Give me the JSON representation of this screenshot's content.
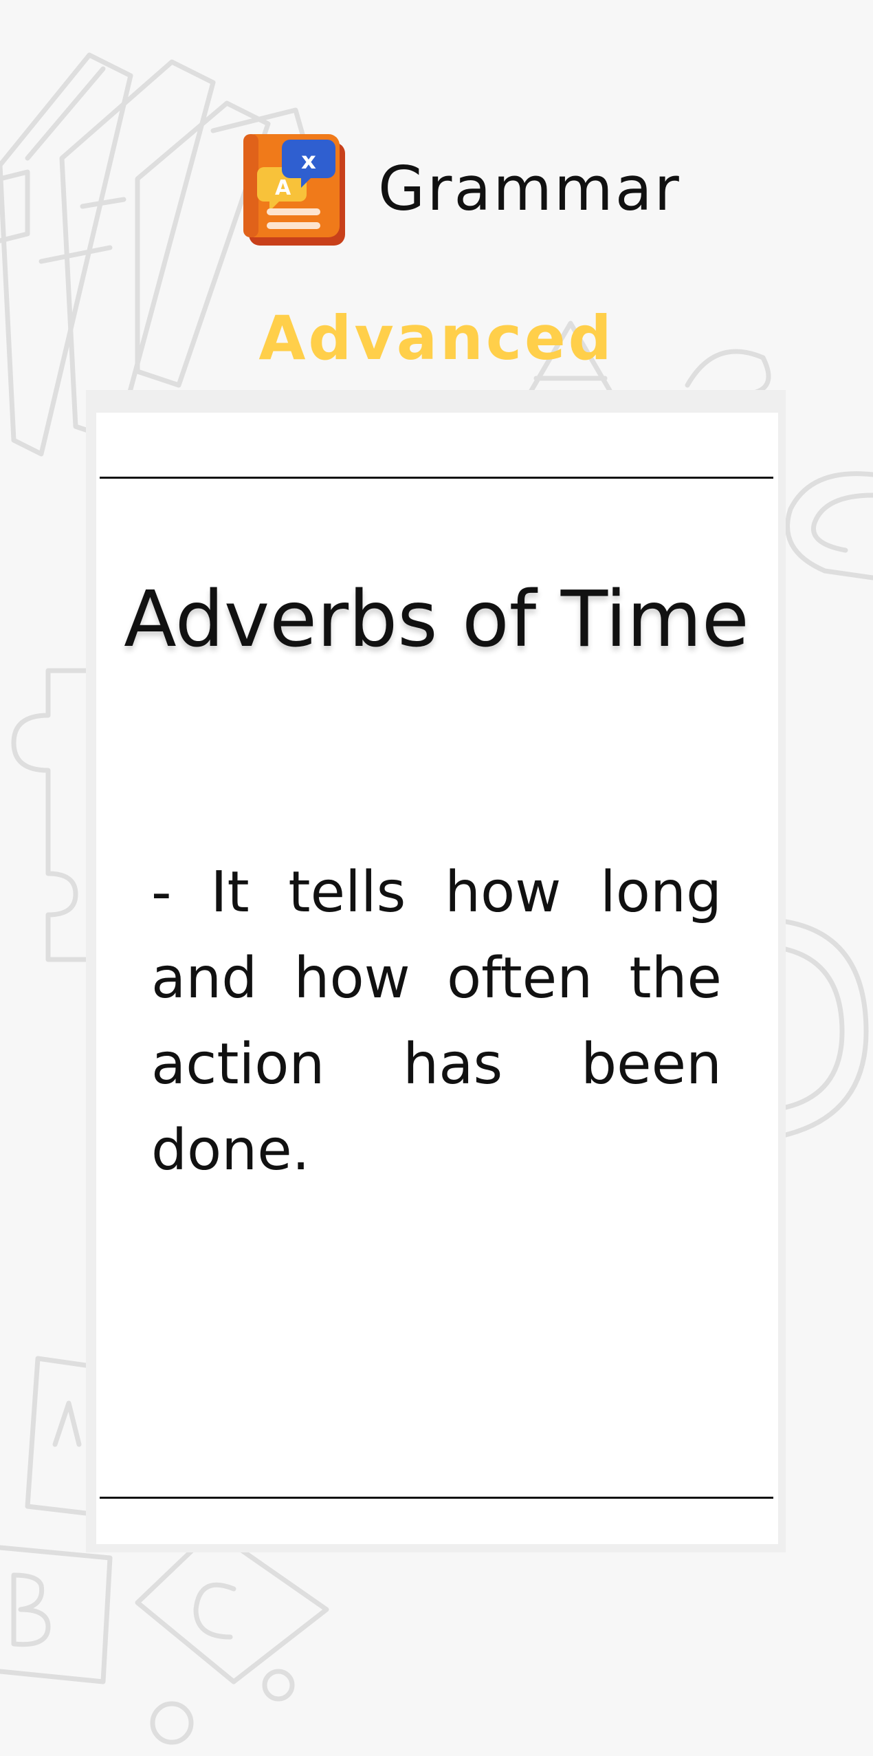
{
  "header": {
    "title": "Grammar",
    "icon": "grammar-book-icon"
  },
  "level": {
    "label": "Advanced"
  },
  "card": {
    "title": "Adverbs of Time",
    "text": " -   It tells how long and how often the action has been done."
  },
  "colors": {
    "background": "#f7f7f7",
    "card": "#ffffff",
    "level_accent": "#ffcf4a",
    "icon_book": "#f07a1a",
    "icon_bubble": "#2f5fd0"
  }
}
